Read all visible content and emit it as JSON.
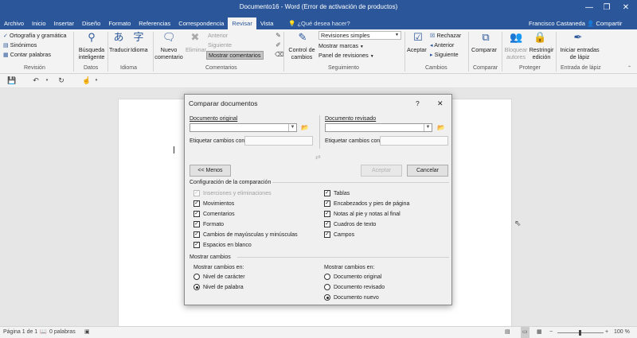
{
  "window": {
    "title": "Documento16 - Word (Error de activación de productos)",
    "minimize_glyph": "—",
    "restore_glyph": "❐",
    "close_glyph": "✕"
  },
  "tabs": [
    "Archivo",
    "Inicio",
    "Insertar",
    "Diseño",
    "Formato",
    "Referencias",
    "Correspondencia",
    "Revisar",
    "Vista"
  ],
  "tell_me": "¿Qué desea hacer?",
  "user": "Francisco Castaneda",
  "share": "Compartir",
  "ribbon": {
    "revision": {
      "spelling": "Ortografía y gramática",
      "synonyms": "Sinónimos",
      "word_count": "Contar palabras",
      "label": "Revisión"
    },
    "datos": {
      "smart_lookup_1": "Búsqueda",
      "smart_lookup_2": "inteligente",
      "label": "Datos"
    },
    "idioma": {
      "translate": "Traducir",
      "language": "Idioma",
      "label": "Idioma"
    },
    "comentarios": {
      "new_1": "Nuevo",
      "new_2": "comentario",
      "delete": "Eliminar",
      "previous": "Anterior",
      "next": "Siguiente",
      "show": "Mostrar comentarios",
      "label": "Comentarios"
    },
    "seguimiento": {
      "track_1": "Control de",
      "track_2": "cambios",
      "simple": "Revisiones simples",
      "show_markup": "Mostrar marcas",
      "pane": "Panel de revisiones",
      "label": "Seguimiento"
    },
    "cambios": {
      "accept": "Aceptar",
      "reject": "Rechazar",
      "previous": "Anterior",
      "next": "Siguiente",
      "label": "Cambios"
    },
    "comparar": {
      "compare": "Comparar",
      "label": "Comparar"
    },
    "proteger": {
      "block_1": "Bloquear",
      "block_2": "autores",
      "restrict_1": "Restringir",
      "restrict_2": "edición",
      "label": "Proteger"
    },
    "tinta": {
      "ink_1": "Iniciar entradas",
      "ink_2": "de lápiz",
      "label": "Entrada de lápiz"
    }
  },
  "dialog": {
    "title": "Comparar documentos",
    "help": "?",
    "close": "✕",
    "original_label": "Documento original",
    "revised_label": "Documento revisado",
    "label_changes_with": "Etiquetar cambios con",
    "less_button": "<< Menos",
    "ok_button": "Aceptar",
    "cancel_button": "Cancelar",
    "comparison_settings": "Configuración de la comparación",
    "settings_left": [
      {
        "label": "Inserciones y eliminaciones",
        "checked": true,
        "disabled": true
      },
      {
        "label": "Movimientos",
        "checked": true,
        "disabled": false
      },
      {
        "label": "Comentarios",
        "checked": true,
        "disabled": false
      },
      {
        "label": "Formato",
        "checked": true,
        "disabled": false
      },
      {
        "label": "Cambios de mayúsculas y minúsculas",
        "checked": true,
        "disabled": false
      },
      {
        "label": "Espacios en blanco",
        "checked": true,
        "disabled": false
      }
    ],
    "settings_right": [
      {
        "label": "Tablas",
        "checked": true
      },
      {
        "label": "Encabezados y pies de página",
        "checked": true
      },
      {
        "label": "Notas al pie y notas al final",
        "checked": true
      },
      {
        "label": "Cuadros de texto",
        "checked": true
      },
      {
        "label": "Campos",
        "checked": true
      }
    ],
    "show_changes": "Mostrar cambios",
    "show_changes_at": "Mostrar cambios en:",
    "level_options": [
      {
        "label": "Nivel de carácter",
        "selected": false
      },
      {
        "label": "Nivel de palabra",
        "selected": true
      }
    ],
    "show_changes_in": "Mostrar cambios en:",
    "doc_options": [
      {
        "label": "Documento original",
        "selected": false
      },
      {
        "label": "Documento revisado",
        "selected": false
      },
      {
        "label": "Documento nuevo",
        "selected": true
      }
    ]
  },
  "status": {
    "page": "Página 1 de 1",
    "words": "0 palabras",
    "zoom": "100 %",
    "zoom_minus": "−",
    "zoom_plus": "+"
  }
}
